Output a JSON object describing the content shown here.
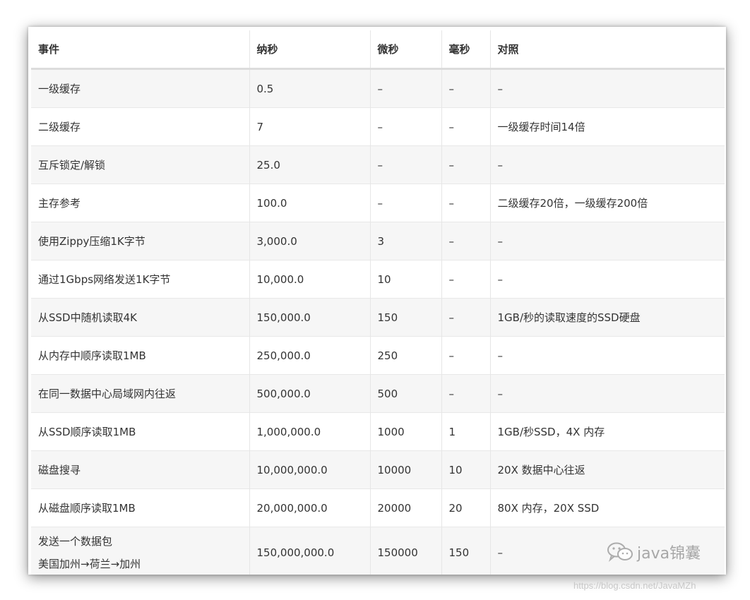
{
  "table": {
    "headers": [
      "事件",
      "纳秒",
      "微秒",
      "毫秒",
      "对照"
    ],
    "rows": [
      {
        "event": "一级缓存",
        "ns": "0.5",
        "us": "–",
        "ms": "–",
        "note": "–"
      },
      {
        "event": "二级缓存",
        "ns": "7",
        "us": "–",
        "ms": "–",
        "note": "一级缓存时间14倍"
      },
      {
        "event": "互斥锁定/解锁",
        "ns": "25.0",
        "us": "–",
        "ms": "–",
        "note": "–"
      },
      {
        "event": "主存参考",
        "ns": "100.0",
        "us": "–",
        "ms": "–",
        "note": "二级缓存20倍，一级缓存200倍"
      },
      {
        "event": "使用Zippy压缩1K字节",
        "ns": "3,000.0",
        "us": "3",
        "ms": "–",
        "note": "–"
      },
      {
        "event": "通过1Gbps网络发送1K字节",
        "ns": "10,000.0",
        "us": "10",
        "ms": "–",
        "note": "–"
      },
      {
        "event": "从SSD中随机读取4K",
        "ns": "150,000.0",
        "us": "150",
        "ms": "–",
        "note": "1GB/秒的读取速度的SSD硬盘"
      },
      {
        "event": "从内存中顺序读取1MB",
        "ns": "250,000.0",
        "us": "250",
        "ms": "–",
        "note": "–"
      },
      {
        "event": "在同一数据中心局域网内往返",
        "ns": "500,000.0",
        "us": "500",
        "ms": "–",
        "note": "–"
      },
      {
        "event": "从SSD顺序读取1MB",
        "ns": "1,000,000.0",
        "us": "1000",
        "ms": "1",
        "note": "1GB/秒SSD，4X 内存"
      },
      {
        "event": "磁盘搜寻",
        "ns": "10,000,000.0",
        "us": "10000",
        "ms": "10",
        "note": "20X 数据中心往返"
      },
      {
        "event": "从磁盘顺序读取1MB",
        "ns": "20,000,000.0",
        "us": "20000",
        "ms": "20",
        "note": "80X 内存，20X SSD"
      },
      {
        "event": "发送一个数据包",
        "event_line2": "美国加州→荷兰→加州",
        "ns": "150,000,000.0",
        "us": "150000",
        "ms": "150",
        "note": "–"
      }
    ]
  },
  "watermark": {
    "text": "java锦囊",
    "icon": "wechat-icon"
  },
  "url": "https://blog.csdn.net/JavaMZh"
}
